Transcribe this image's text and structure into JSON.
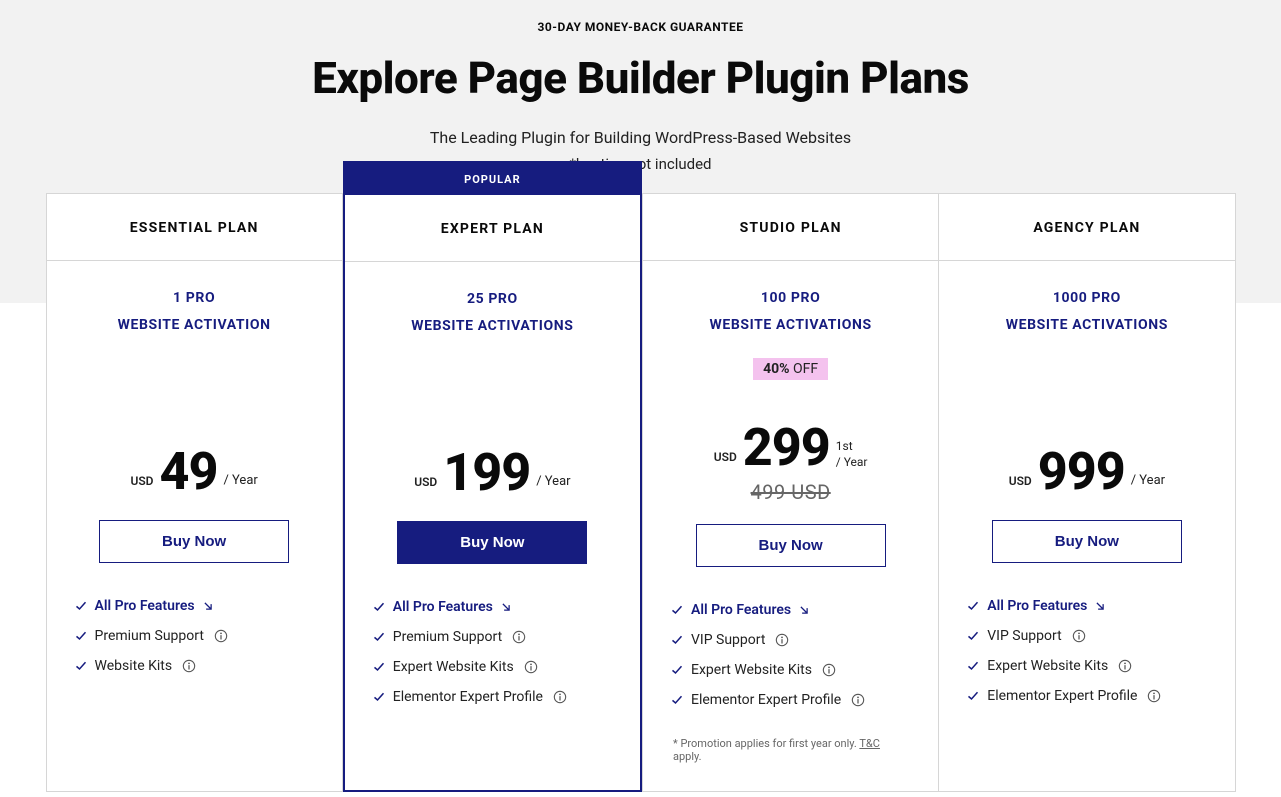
{
  "hero": {
    "guarantee": "30-DAY MONEY-BACK GUARANTEE",
    "headline": "Explore Page Builder Plugin Plans",
    "subhead": "The Leading Plugin for Building WordPress-Based Websites",
    "note": "*hosting not included"
  },
  "common": {
    "currency": "USD",
    "per_year": "/ Year",
    "first_year_line1": "1st",
    "first_year_line2": "/ Year",
    "buy_label": "Buy Now",
    "popular_label": "POPULAR"
  },
  "features_catalog": {
    "all_pro": "All Pro Features",
    "premium_support": "Premium Support",
    "vip_support": "VIP Support",
    "website_kits": "Website Kits",
    "expert_kits": "Expert Website Kits",
    "expert_profile": "Elementor Expert Profile"
  },
  "plans": [
    {
      "name": "ESSENTIAL PLAN",
      "activation_line1": "1 PRO",
      "activation_line2": "WEBSITE ACTIVATION",
      "amount": "49",
      "features": [
        "all_pro_link",
        "premium_support",
        "website_kits"
      ]
    },
    {
      "name": "EXPERT PLAN",
      "popular": true,
      "activation_line1": "25 PRO",
      "activation_line2": "WEBSITE ACTIVATIONS",
      "amount": "199",
      "features": [
        "all_pro_link",
        "premium_support",
        "expert_kits",
        "expert_profile"
      ]
    },
    {
      "name": "STUDIO PLAN",
      "activation_line1": "100 PRO",
      "activation_line2": "WEBSITE ACTIVATIONS",
      "off_percent": "40%",
      "off_text": "OFF",
      "amount": "299",
      "strike": "499 USD",
      "first_year": true,
      "promo_note_prefix": "* Promotion applies for first year only. ",
      "promo_note_tc": "T&C",
      "promo_note_suffix": " apply.",
      "features": [
        "all_pro_link",
        "vip_support",
        "expert_kits",
        "expert_profile"
      ]
    },
    {
      "name": "AGENCY PLAN",
      "activation_line1": "1000 PRO",
      "activation_line2": "WEBSITE ACTIVATIONS",
      "amount": "999",
      "features": [
        "all_pro_link",
        "vip_support",
        "expert_kits",
        "expert_profile"
      ]
    }
  ]
}
